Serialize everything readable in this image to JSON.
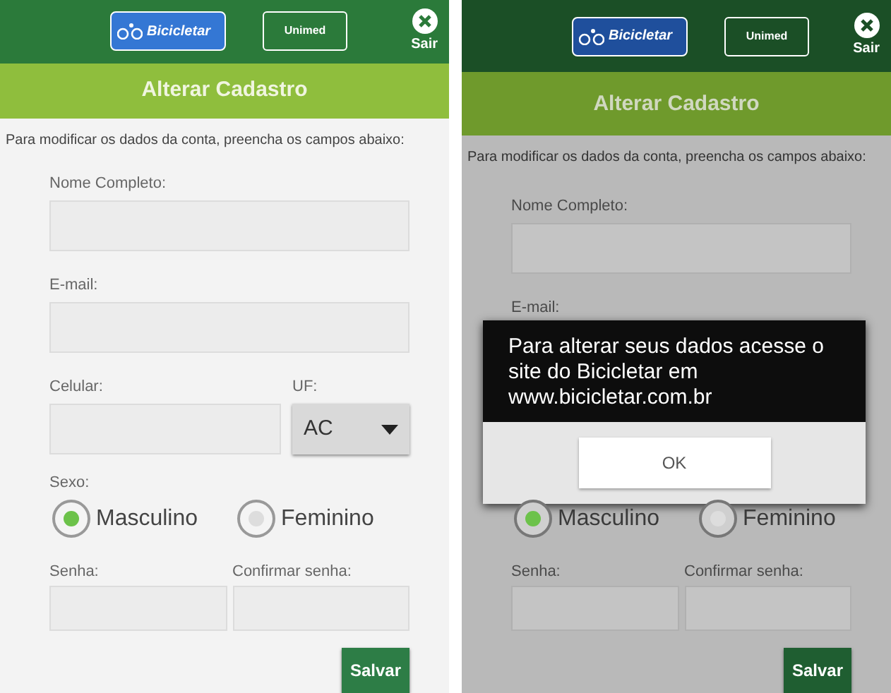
{
  "screens": [
    {
      "dimmed": false,
      "header": {
        "brand": "Bicicletar",
        "partner": "Unimed",
        "exit_label": "Sair"
      },
      "title": "Alterar Cadastro",
      "intro": "Para modificar os dados da conta, preencha os campos abaixo:",
      "items": [
        {
          "kind": "text_field",
          "label": "Nome Completo:"
        },
        {
          "kind": "text_field",
          "label": "E-mail:"
        },
        {
          "kind": "phone_uf",
          "label": "Celular:",
          "uf_label": "UF:",
          "uf_value": "AC"
        },
        {
          "kind": "gender",
          "label": "Sexo:",
          "options": [
            {
              "label": "Masculino",
              "selected": true
            },
            {
              "label": "Feminino",
              "selected": false
            }
          ]
        },
        {
          "kind": "password_pair",
          "labels": [
            "Senha:",
            "Confirmar senha:"
          ]
        },
        {
          "kind": "submit",
          "label": "Salvar"
        }
      ]
    },
    {
      "dimmed": true,
      "header": {
        "brand": "Bicicletar",
        "partner": "Unimed",
        "exit_label": "Sair"
      },
      "title": "Alterar Cadastro",
      "intro": "Para modificar os dados da conta, preencha os campos abaixo:",
      "items": [
        {
          "kind": "text_field",
          "label": "Nome Completo:"
        },
        {
          "kind": "label_only",
          "label": "E-mail:"
        },
        {
          "kind": "dialog",
          "message": "Para alterar seus dados acesse o site do Bicicletar em www.bicicletar.com.br",
          "button": "OK"
        },
        {
          "kind": "gender_options",
          "options": [
            {
              "label": "Masculino",
              "selected": true
            },
            {
              "label": "Feminino",
              "selected": false
            }
          ]
        },
        {
          "kind": "password_pair",
          "labels": [
            "Senha:",
            "Confirmar senha:"
          ]
        },
        {
          "kind": "submit",
          "label": "Salvar"
        }
      ]
    }
  ]
}
